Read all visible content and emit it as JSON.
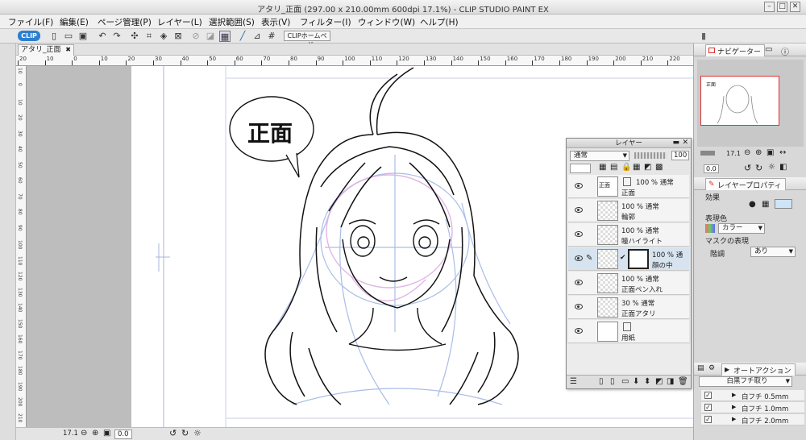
{
  "window": {
    "title": "アタリ_正面 (297.00 x 210.00mm 600dpi 17.1%) - CLIP STUDIO PAINT EX"
  },
  "menu": [
    "ファイル(F)",
    "編集(E)",
    "ページ管理(P)",
    "レイヤー(L)",
    "選択範囲(S)",
    "表示(V)",
    "フィルター(I)",
    "ウィンドウ(W)",
    "ヘルプ(H)"
  ],
  "toolbar": {
    "clip_logo": "CLIP",
    "clip_home_label": "CLIPホームページ"
  },
  "document_tab": {
    "label": "アタリ_正面",
    "close": "✖"
  },
  "ruler": {
    "h_ticks": [
      "20",
      "10",
      "0",
      "10",
      "20",
      "30",
      "40",
      "50",
      "60",
      "70",
      "80",
      "90",
      "100",
      "110",
      "120",
      "130",
      "140",
      "150",
      "160",
      "170",
      "180",
      "190",
      "200",
      "210",
      "220"
    ],
    "v_ticks": [
      "10",
      "0",
      "10",
      "20",
      "30",
      "40",
      "50",
      "60",
      "70",
      "80",
      "90",
      "100",
      "110",
      "120",
      "130",
      "140",
      "150",
      "160",
      "170",
      "180",
      "190",
      "200",
      "210"
    ]
  },
  "canvas": {
    "speech_text": "正面"
  },
  "status": {
    "zoom": "17.1",
    "angle": "0.0"
  },
  "navigator": {
    "tab_label": "ナビゲーター",
    "zoom": "17.1",
    "angle": "0.0"
  },
  "layer_panel": {
    "title": "レイヤー",
    "blend_mode": "通常",
    "opacity": "100",
    "layers": [
      {
        "mode": "100 % 通常",
        "name": "正面",
        "selected": false
      },
      {
        "mode": "100 % 通常",
        "name": "輪郭",
        "selected": false
      },
      {
        "mode": "100 % 通常",
        "name": "瞳ハイライト",
        "selected": false
      },
      {
        "mode": "100 % 通",
        "name": "顔の中",
        "selected": true
      },
      {
        "mode": "100 % 通常",
        "name": "正面ペン入れ",
        "selected": false
      },
      {
        "mode": "30 % 通常",
        "name": "正面アタリ",
        "selected": false
      },
      {
        "mode": "",
        "name": "用紙",
        "selected": false
      }
    ]
  },
  "layer_property": {
    "tab_label": "レイヤープロパティ",
    "effect_label": "効果",
    "color_label": "表現色",
    "color_value": "カラー",
    "mask_label": "マスクの表現",
    "gradation_label": "階調",
    "gradation_value": "あり"
  },
  "auto_action": {
    "tab_label": "オートアクション",
    "set_name": "白黒フチ取り",
    "items": [
      "白フチ 0.5mm",
      "白フチ 1.0mm",
      "白フチ 2.0mm"
    ]
  }
}
